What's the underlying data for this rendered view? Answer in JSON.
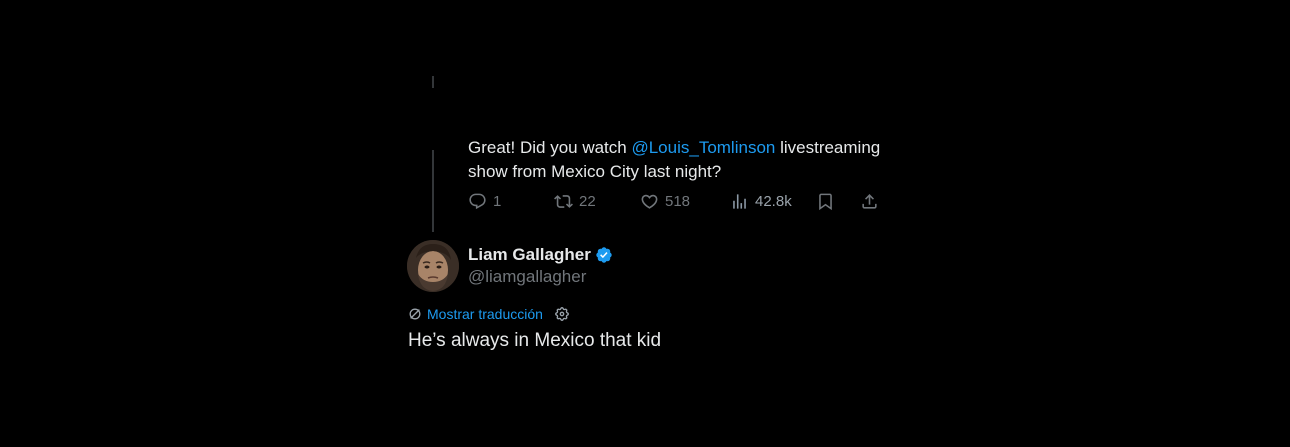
{
  "parent_tweet": {
    "text_before": "Great! Did you watch ",
    "mention": "@Louis_Tomlinson",
    "text_after": " livestreaming show from Mexico City last night?",
    "actions": {
      "replies": "1",
      "retweets": "22",
      "likes": "518",
      "views": "42.8k"
    }
  },
  "reply": {
    "author_name": "Liam Gallagher",
    "author_handle": "@liamgallagher",
    "translate_label": "Mostrar traducción",
    "text": "He’s always in Mexico that kid"
  },
  "colors": {
    "background": "#000000",
    "text": "#e7e9ea",
    "secondary": "#71767b",
    "accent": "#1d9bf0",
    "thread_line": "#333639"
  },
  "icons": {
    "reply": "reply-icon",
    "retweet": "retweet-icon",
    "like": "heart-icon",
    "views": "views-icon",
    "bookmark": "bookmark-icon",
    "share": "share-icon",
    "verified": "verified-badge-icon",
    "translate": "translate-icon",
    "settings": "gear-icon"
  }
}
